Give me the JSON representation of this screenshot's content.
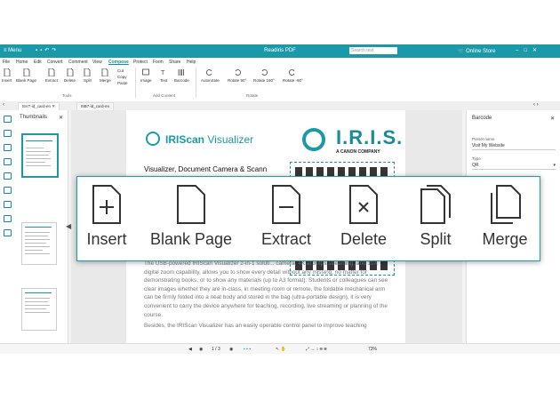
{
  "app": {
    "title": "Readiris PDF",
    "menu_label": "≡ Menu",
    "search_placeholder": "Search text",
    "online_store": "Online Store"
  },
  "menubar": [
    "File",
    "Home",
    "Edit",
    "Convert",
    "Comment",
    "View",
    "Compose",
    "Protect",
    "Form",
    "Share",
    "Help"
  ],
  "active_menu": "Compose",
  "ribbon": {
    "tools": [
      "Insert",
      "Blank Page",
      "Extract",
      "Delete",
      "Split",
      "Merge"
    ],
    "clipboard": [
      "Cut",
      "Copy",
      "Paste"
    ],
    "content": [
      "Image",
      "Text",
      "Barcode"
    ],
    "rotate": [
      "Autorotate",
      "Rotate 90°",
      "Rotate 180°",
      "Rotate -90°"
    ],
    "groups": {
      "tools": "Tools",
      "content": "Add Content",
      "rotate": "Rotate"
    }
  },
  "doc_tabs": [
    "I5V7-id_card-en",
    "I5B7-id_card-en"
  ],
  "thumbnails": {
    "title": "Thumbnails"
  },
  "document": {
    "brand_left": "IRIScan",
    "brand_left_sub": "Visualizer",
    "brand_right": "I.R.I.S.",
    "brand_right_sub": "A CANON COMPANY",
    "heading": "Visualizer, Document Camera & Scann",
    "paragraphs": [
      "The USB-powered IRIScan Visualizer 2-in-1 soluti... camera, 4K at 30fps streaming, and 10X digital zoom capability, allows you to show every detail without any missing, no matter for demonstrating books, or to show any materials (up to A3 format). Students or colleagues can see clear images whether they are in-class, in meeting room or remote, the foldable mechanical arm can be firmly folded into a neat body and stored in the bag (ultra-portable design), it is very convenient to carry the device anywhere for teaching, recording, live streaming or planning of the course.",
      "Besides, the IRIScan Visualizer has an easily operable control panel to improve teaching"
    ]
  },
  "barcode_panel": {
    "title": "Barcode",
    "preset_label": "Preset name",
    "preset_value": "Visit My Website",
    "type_label": "Type",
    "type_value": "QR"
  },
  "statusbar": {
    "page": "1 / 3",
    "zoom": "73%"
  },
  "overlay_tools": [
    {
      "name": "insert",
      "label": "Insert"
    },
    {
      "name": "blank-page",
      "label": "Blank Page"
    },
    {
      "name": "extract",
      "label": "Extract"
    },
    {
      "name": "delete",
      "label": "Delete"
    },
    {
      "name": "split",
      "label": "Split"
    },
    {
      "name": "merge",
      "label": "Merge"
    }
  ],
  "colors": {
    "accent": "#1a9aa8",
    "titlebar": "#1a9aa8"
  }
}
